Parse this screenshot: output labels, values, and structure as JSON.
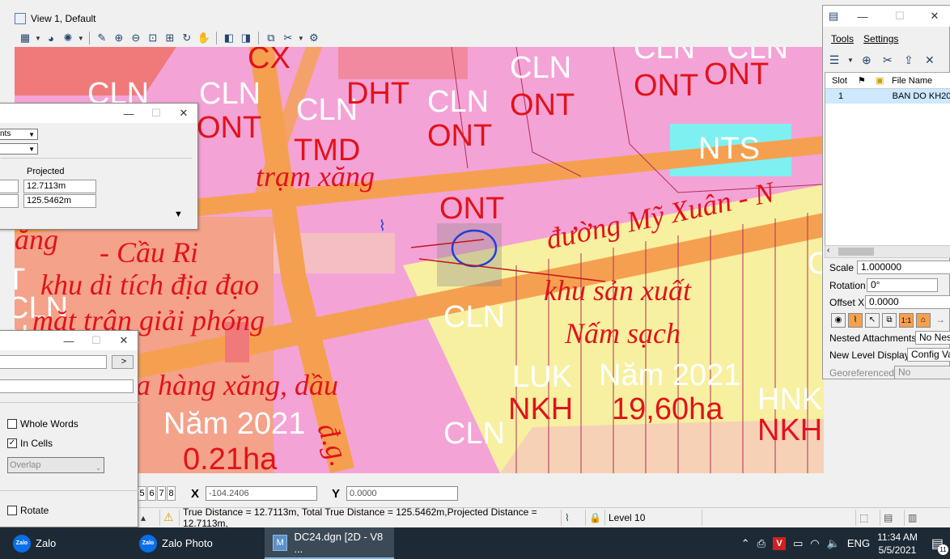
{
  "view": {
    "title": "View 1, Default"
  },
  "map": {
    "labels_white": [
      "CLN",
      "CLN",
      "CLN",
      "CLN",
      "CLN",
      "CLN",
      "NTS",
      "CLN",
      "CLN",
      "LUK",
      "Năm 2021",
      "HNK",
      "Năm 2021",
      "CLN",
      "CLN",
      "CLN",
      "T",
      "N"
    ],
    "labels_red": [
      "CX",
      "DHT",
      "ONT",
      "ONT",
      "ONT",
      "ONT",
      "ONT",
      "ONT",
      "TMD",
      "NKH",
      "NKH",
      "19,60ha",
      "0.21ha"
    ],
    "annotations": [
      "trạm xăng",
      "đường Mỹ Xuân - N",
      "- Cầu Ri",
      "khu di tích địa đạo",
      "mặt trận giải phóng",
      "khu sản xuất",
      "Nấm sạch",
      "a hàng xăng, dầu",
      "đ.g.",
      "ăng"
    ],
    "colors": {
      "land_pink": "#f4a3d6",
      "land_yellow": "#f7f0a0",
      "land_salmon": "#f4a28a",
      "land_cyan": "#7ff0f2",
      "road_orange": "#f5a050",
      "label_red": "#e2121a",
      "label_white": "#ffffff"
    }
  },
  "measure_dialog": {
    "select1": "nts",
    "select2": "",
    "col_header": "Projected",
    "value1": "12.7113m",
    "value2": "125.5462m",
    "expand_icon": "triangle-down-icon"
  },
  "find_dialog": {
    "go_button": ">",
    "whole_words": "Whole Words",
    "in_cells": "In Cells",
    "in_cells_checked": true,
    "overlap": "Overlap",
    "rotate": "Rotate"
  },
  "coord": {
    "view_numbers": [
      "5",
      "6",
      "7",
      "8"
    ],
    "x_label": "X",
    "x_value": "-104.2406",
    "y_label": "Y",
    "y_value": "0.0000"
  },
  "status": {
    "message": "True Distance = 12.7113m, Total True Distance = 125.5462m,Projected Distance = 12.7113m,",
    "level": "Level 10"
  },
  "references": {
    "menu_tools": "Tools",
    "menu_settings": "Settings",
    "col_slot": "Slot",
    "col_file": "File Name",
    "row_slot": "1",
    "row_file": "BAN DO KH20",
    "scale_label": "Scale",
    "scale_value": "1.000000",
    "rotation_label": "Rotation",
    "rotation_value": "0°",
    "offset_label": "Offset X",
    "offset_value": "0.0000",
    "nested_label": "Nested Attachments:",
    "nested_value": "No Nest",
    "newlevel_label": "New Level Display:",
    "newlevel_value": "Config Var",
    "geo_label": "Georeferenced:",
    "geo_value": "No"
  },
  "taskbar": {
    "zalo": "Zalo",
    "zalo_photo": "Zalo Photo",
    "dgn": "DC24.dgn [2D - V8 ...",
    "lang": "ENG",
    "time": "11:34 AM",
    "date": "5/5/2021",
    "notif_count": "11"
  }
}
